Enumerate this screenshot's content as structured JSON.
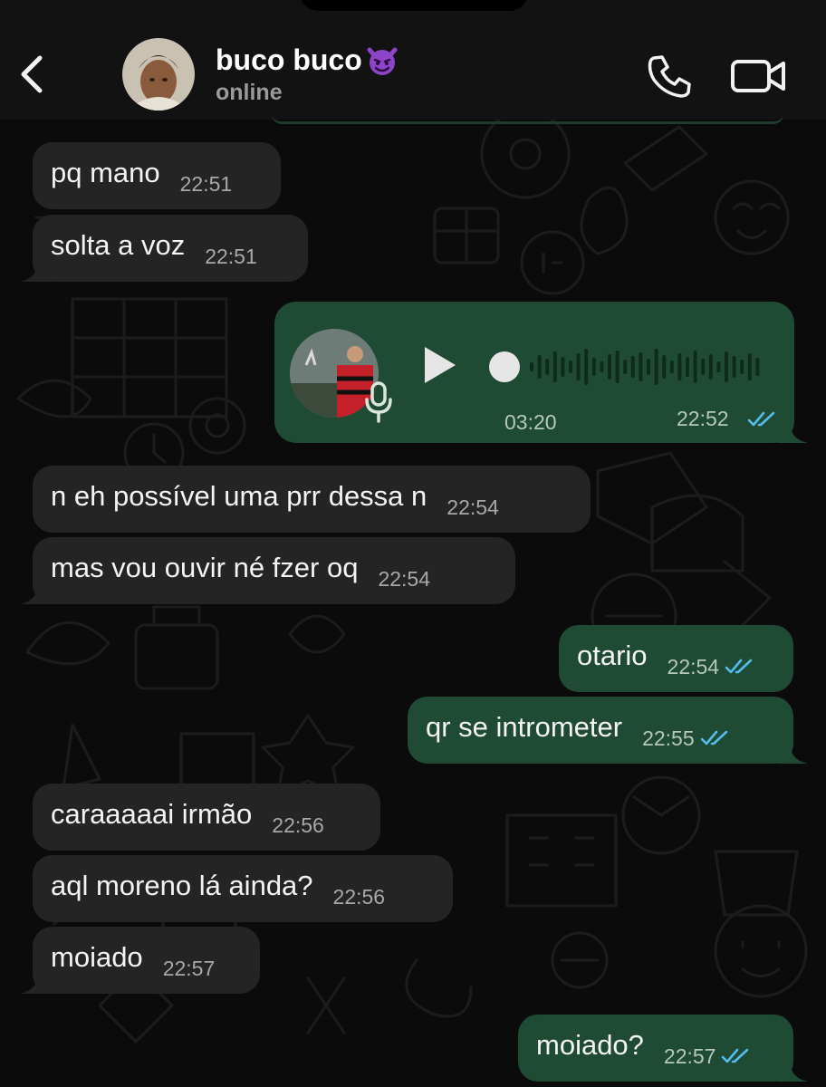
{
  "header": {
    "contact_name": "buco buco",
    "status": "online",
    "icons": [
      "chevron-left-icon",
      "avatar",
      "devil-emoji-icon",
      "phone-icon",
      "video-camera-icon"
    ]
  },
  "colors": {
    "incoming_bubble": "#242424",
    "outgoing_bubble": "#1f4a33",
    "read_ticks": "#53bdeb",
    "background": "#0b0b0b"
  },
  "messages": [
    {
      "dir": "in",
      "text": "pq mano",
      "time": "22:51"
    },
    {
      "dir": "in",
      "text": "solta a voz",
      "time": "22:51"
    },
    {
      "dir": "out",
      "type": "voice",
      "duration": "03:20",
      "time": "22:52",
      "read": true
    },
    {
      "dir": "in",
      "text": "n eh possível uma prr dessa n",
      "time": "22:54"
    },
    {
      "dir": "in",
      "text": "mas vou ouvir né fzer oq",
      "time": "22:54"
    },
    {
      "dir": "out",
      "text": "otario",
      "time": "22:54",
      "read": true
    },
    {
      "dir": "out",
      "text": "qr se intrometer",
      "time": "22:55",
      "read": true
    },
    {
      "dir": "in",
      "text": "caraaaaai irmão",
      "time": "22:56"
    },
    {
      "dir": "in",
      "text": "aql moreno lá ainda?",
      "time": "22:56"
    },
    {
      "dir": "in",
      "text": "moiado",
      "time": "22:57"
    },
    {
      "dir": "out",
      "text": "moiado?",
      "time": "22:57",
      "read": true
    }
  ]
}
